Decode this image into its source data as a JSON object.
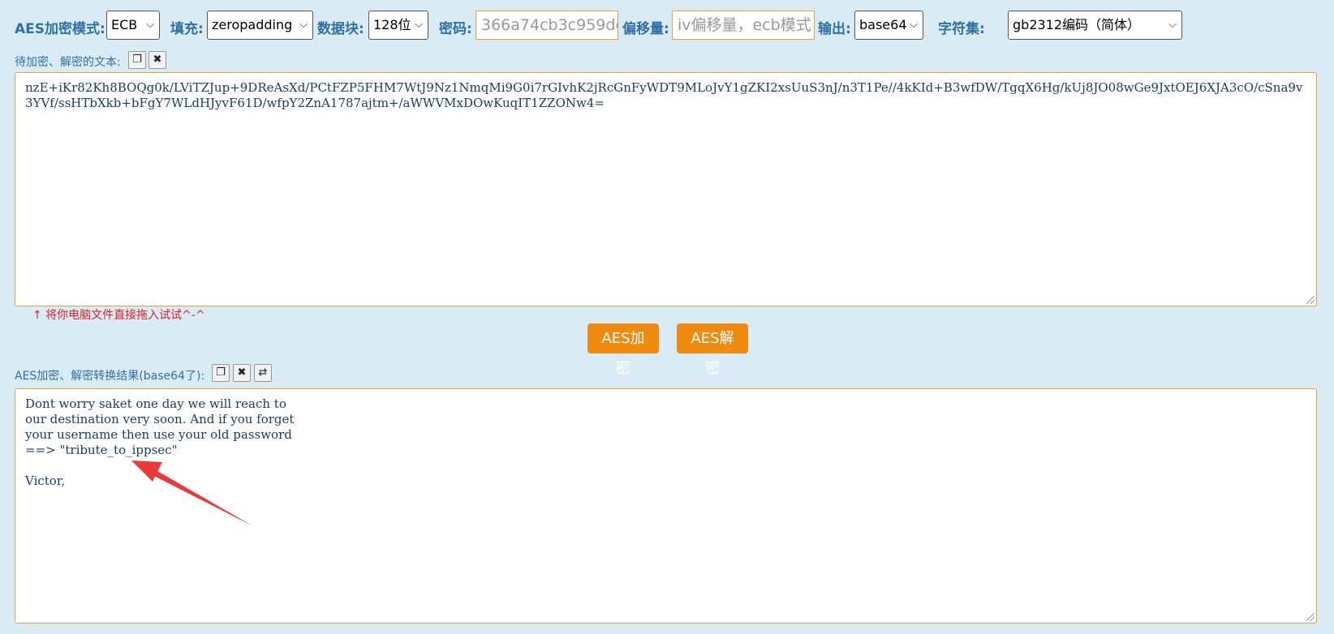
{
  "toolbar": {
    "mode_label": "AES加密模式:",
    "mode_value": "ECB",
    "padding_label": "填充:",
    "padding_value": "zeropadding",
    "block_label": "数据块:",
    "block_value": "128位",
    "password_label": "密码:",
    "password_value": "366a74cb3c959de",
    "iv_label": "偏移量:",
    "iv_placeholder": "iv偏移量，ecb模式",
    "output_label": "输出:",
    "output_value": "base64",
    "charset_label": "字符集:",
    "charset_value": "gb2312编码（简体）"
  },
  "input_section": {
    "label": "待加密、解密的文本:",
    "text": "nzE+iKr82Kh8BOQg0k/LViTZJup+9DReAsXd/PCtFZP5FHM7WtJ9Nz1NmqMi9G0i7rGIvhK2jRcGnFyWDT9MLoJvY1gZKI2xsUuS3nJ/n3T1Pe//4kKId+B3wfDW/TgqX6Hg/kUj8JO08wGe9JxtOEJ6XJA3cO/cSna9v3YVf/ssHTbXkb+bFgY7WLdHJyvF61D/wfpY2ZnA1787ajtm+/aWWVMxDOwKuqIT1ZZONw4=",
    "drop_hint": "↑ 将你电脑文件直接拖入试试^-^"
  },
  "actions": {
    "encrypt": "AES加密",
    "decrypt": "AES解密"
  },
  "output_section": {
    "label": "AES加密、解密转换结果(base64了):",
    "text": "Dont worry saket one day we will reach to\nour destination very soon. And if you forget\nyour username then use your old password\n==> \"tribute_to_ippsec\"\n\nVictor,"
  },
  "icons": {
    "copy": "copy-icon",
    "clear": "close-icon",
    "swap": "swap-icon"
  },
  "colors": {
    "background": "#d9ecf5",
    "label": "#2f6fa6",
    "accent": "#ef8c10",
    "border": "#e7a33a",
    "arrow": "#e83a3a",
    "hint": "#e02020"
  }
}
